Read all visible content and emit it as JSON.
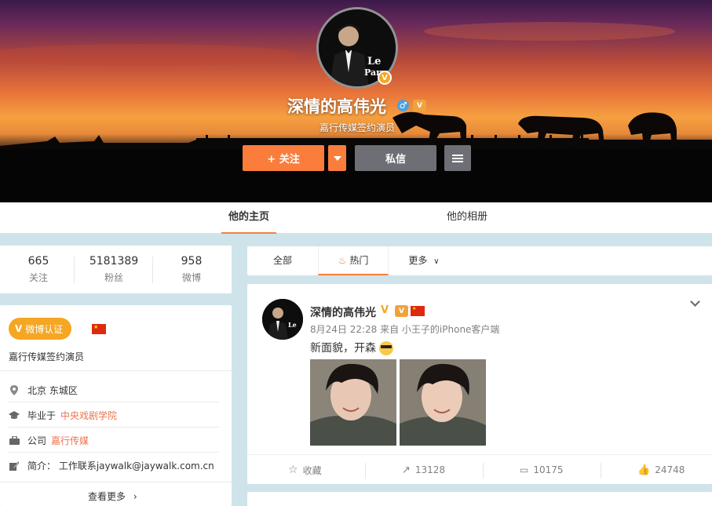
{
  "profile": {
    "name": "深情的高伟光",
    "description": "嘉行传媒签约演员",
    "avatar_text": "Le Parrain"
  },
  "actions": {
    "follow": "+ 关注",
    "message": "私信"
  },
  "tabs": {
    "home": "他的主页",
    "album": "他的相册"
  },
  "stats": [
    {
      "value": "665",
      "label": "关注"
    },
    {
      "value": "5181389",
      "label": "粉丝"
    },
    {
      "value": "958",
      "label": "微博"
    }
  ],
  "info": {
    "verify_label": "微博认证",
    "verify_desc": "嘉行传媒签约演员",
    "location": "北京 东城区",
    "edu_prefix": "毕业于",
    "edu_school": "中央戏剧学院",
    "company_prefix": "公司",
    "company_name": "嘉行传媒",
    "bio": "简介： 工作联系jaywalk@jaywalk.com.cn",
    "more": "查看更多"
  },
  "feed_tabs": {
    "all": "全部",
    "hot": "热门",
    "more": "更多"
  },
  "post": {
    "author": "深情的高伟光",
    "meta": "8月24日 22:28 来自 小王子的iPhone客户端",
    "text": "新面貌，开森",
    "favorite": "收藏",
    "repost": "13128",
    "comment": "10175",
    "like": "24748"
  },
  "colors": {
    "accent": "#fa7d3c",
    "gold": "#f5a623",
    "link": "#eb7350"
  }
}
